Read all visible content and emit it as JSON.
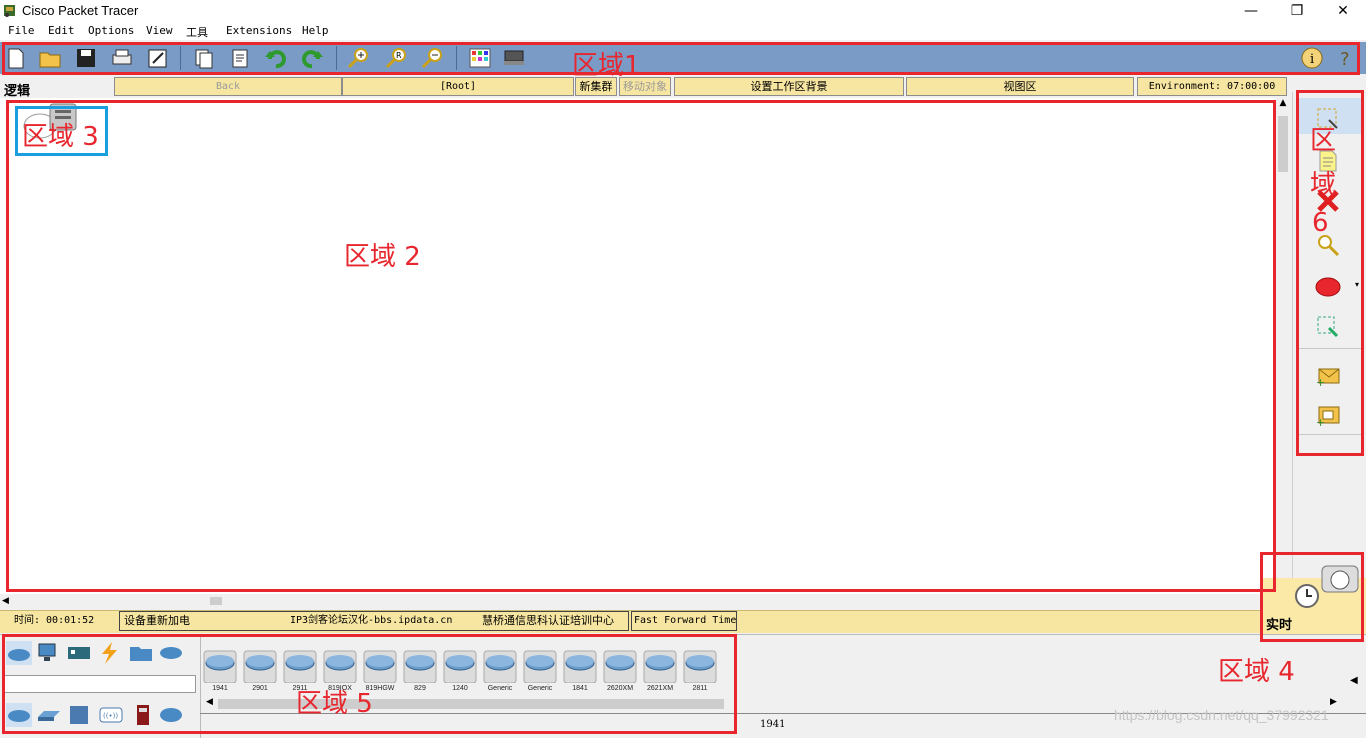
{
  "window": {
    "title": "Cisco Packet Tracer",
    "minimize": "—",
    "maximize": "❐",
    "close": "✕"
  },
  "menu": [
    "File",
    "Edit",
    "Options",
    "View",
    "工具",
    "Extensions",
    "Help"
  ],
  "workspace_bar": {
    "mode_label": "逻辑",
    "back": "Back",
    "root": "[Root]",
    "new_cluster": "新集群",
    "move_object": "移动对象",
    "set_background": "设置工作区背景",
    "viewport": "视图区",
    "environment": "Environment: 07:00:00"
  },
  "status_bar": {
    "time": "时间: 00:01:52",
    "power_cycle": "设备重新加电",
    "credit1": "IP3剑客论坛汉化-bbs.ipdata.cn",
    "credit2": "慧桥通信思科认证培训中心",
    "fast_forward": "Fast Forward Time"
  },
  "realtime": {
    "label": "实时"
  },
  "devices": [
    "1941",
    "2901",
    "2911",
    "819IOX",
    "819HGW",
    "829",
    "1240",
    "Generic",
    "Generic",
    "1841",
    "2620XM",
    "2621XM",
    "2811"
  ],
  "selected_device": "1941",
  "watermark": "https://blog.csdn.net/qq_37992321",
  "annotations": {
    "zone1": "区域1",
    "zone2": "区域 2",
    "zone3": "区域 3",
    "zone4": "区域 4",
    "zone5": "区域 5",
    "zone6_a": "区",
    "zone6_b": "域",
    "zone6_c": "6"
  },
  "colors": {
    "toolbar": "#7b9bc7",
    "statusbar": "#f7e6a1",
    "annotation_red": "#e8262e",
    "annotation_blue": "#1a9ee0"
  }
}
